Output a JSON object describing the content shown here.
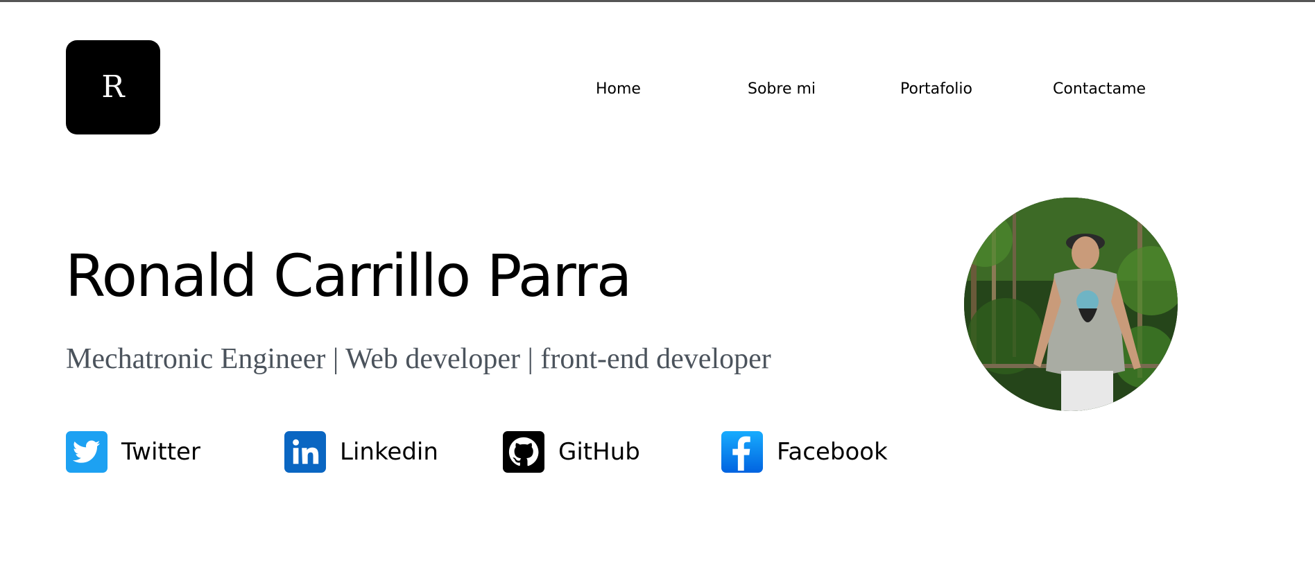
{
  "nav": {
    "home": "Home",
    "about": "Sobre mi",
    "portfolio": "Portafolio",
    "contact": "Contactame"
  },
  "logo": {
    "letter": "R"
  },
  "hero": {
    "name": "Ronald Carrillo Parra",
    "subtitle": "Mechatronic Engineer | Web developer | front-end developer"
  },
  "socials": [
    {
      "label": "Twitter",
      "icon": "twitter-icon",
      "color": "#1da1f2"
    },
    {
      "label": "Linkedin",
      "icon": "linkedin-icon",
      "color": "#0a66c2"
    },
    {
      "label": "GitHub",
      "icon": "github-icon",
      "color": "#000000"
    },
    {
      "label": "Facebook",
      "icon": "facebook-icon",
      "color": "#1877f2"
    }
  ],
  "colors": {
    "subtitle": "#4b535c",
    "logo_bg": "#000000"
  }
}
